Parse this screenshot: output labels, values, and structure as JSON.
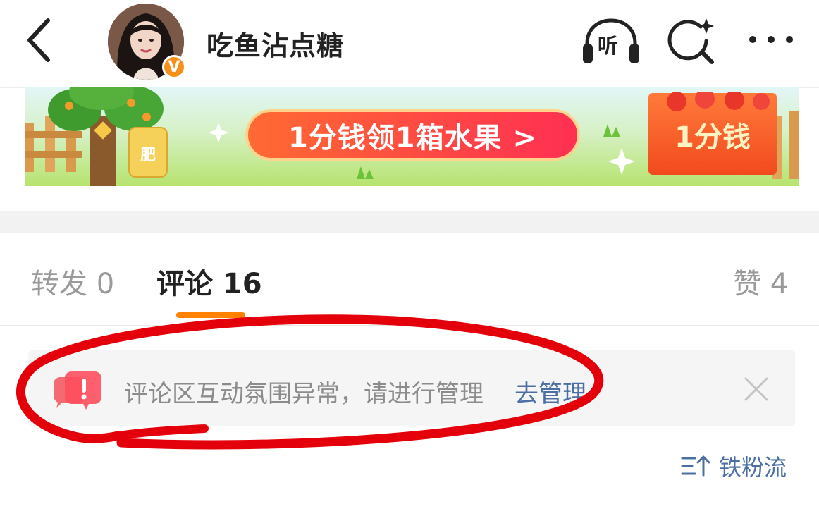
{
  "header": {
    "username": "吃鱼沾点糖",
    "verified_badge": "V",
    "listen_label": "听",
    "icons": {
      "back": "back-chevron-icon",
      "listen": "headphones-icon",
      "search": "search-sparkle-icon",
      "more": "more-dots-icon"
    }
  },
  "banner": {
    "main_text": "1分钱领1箱水果 >",
    "box_text": "1分钱",
    "bag_text": "肥"
  },
  "tabs": [
    {
      "label": "转发 0"
    },
    {
      "label": "评论 16"
    },
    {
      "label": "赞 4"
    }
  ],
  "active_tab": "评论 16",
  "notice": {
    "message": "评论区互动氛围异常，请进行管理",
    "action_label": "去管理",
    "icon": "alert-speech-icon"
  },
  "sort": {
    "label": "铁粉流",
    "icon": "sort-arrow-icon"
  },
  "colors": {
    "accent_orange": "#ff8200",
    "link_blue": "#4c6fa3",
    "annotation_red": "#e3000b",
    "badge_orange": "#f5901a"
  }
}
